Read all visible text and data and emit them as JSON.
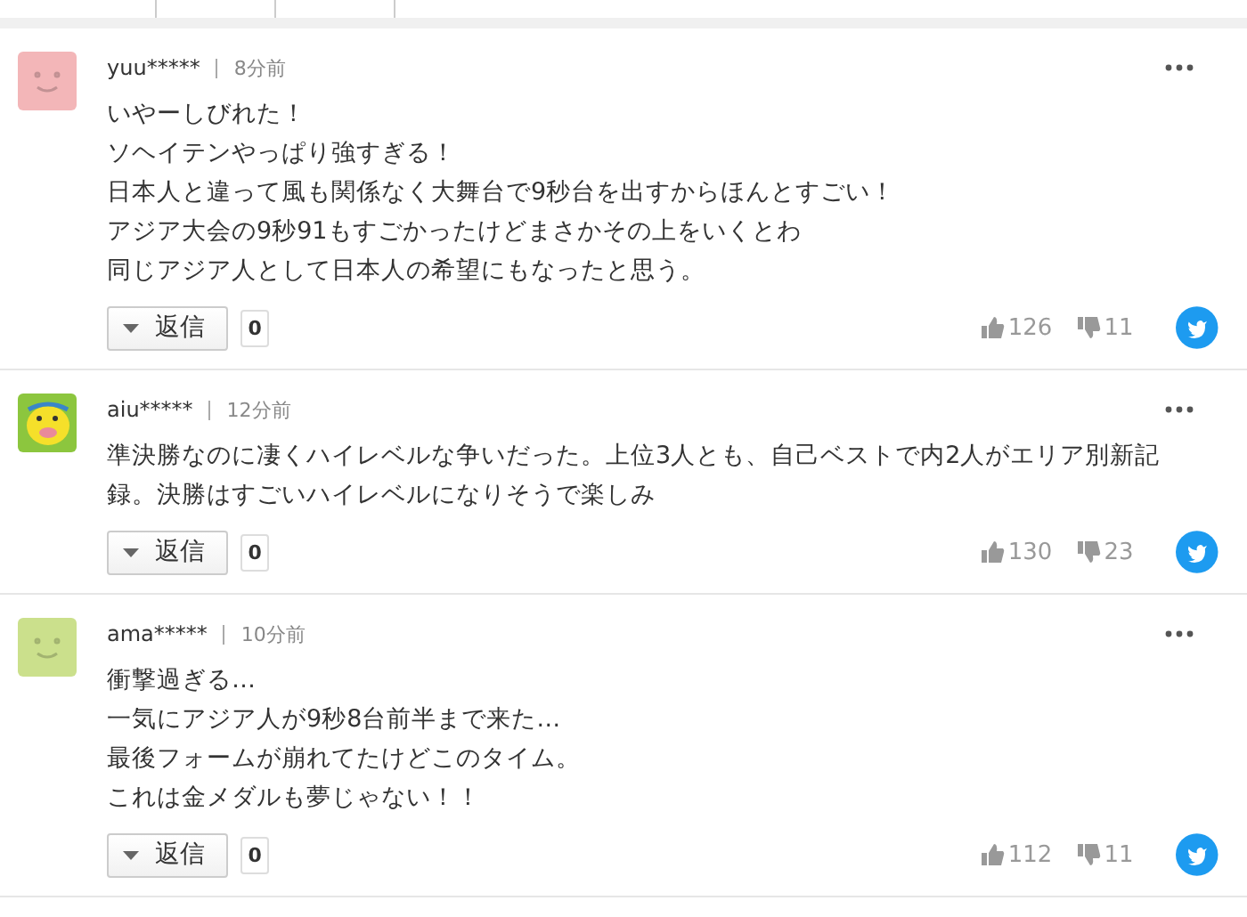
{
  "comments": [
    {
      "avatar": {
        "kind": "smiley",
        "color": "#f3b6b8"
      },
      "user": "yuu*****",
      "time": "8分前",
      "lines": [
        "いやーしびれた！",
        "ソヘイテンやっぱり強すぎる！",
        "日本人と違って風も関係なく大舞台で9秒台を出すからほんとすごい！",
        "アジア大会の9秒91もすごかったけどまさかその上をいくとわ",
        "同じアジア人として日本人の希望にもなったと思う。"
      ],
      "reply_label": "返信",
      "reply_count": "0",
      "likes": "126",
      "dislikes": "11"
    },
    {
      "avatar": {
        "kind": "character",
        "color": "#8cc63e"
      },
      "user": "aiu*****",
      "time": "12分前",
      "lines": [
        "準決勝なのに凄くハイレベルな争いだった。上位3人とも、自己ベストで内2人がエリア別新記録。決勝はすごいハイレベルになりそうで楽しみ"
      ],
      "reply_label": "返信",
      "reply_count": "0",
      "likes": "130",
      "dislikes": "23"
    },
    {
      "avatar": {
        "kind": "smiley",
        "color": "#cbe08c"
      },
      "user": "ama*****",
      "time": "10分前",
      "lines": [
        "衝撃過ぎる…",
        "一気にアジア人が9秒8台前半まで来た…",
        "最後フォームが崩れてたけどこのタイム。",
        "これは金メダルも夢じゃない！！"
      ],
      "reply_label": "返信",
      "reply_count": "0",
      "likes": "112",
      "dislikes": "11"
    }
  ]
}
